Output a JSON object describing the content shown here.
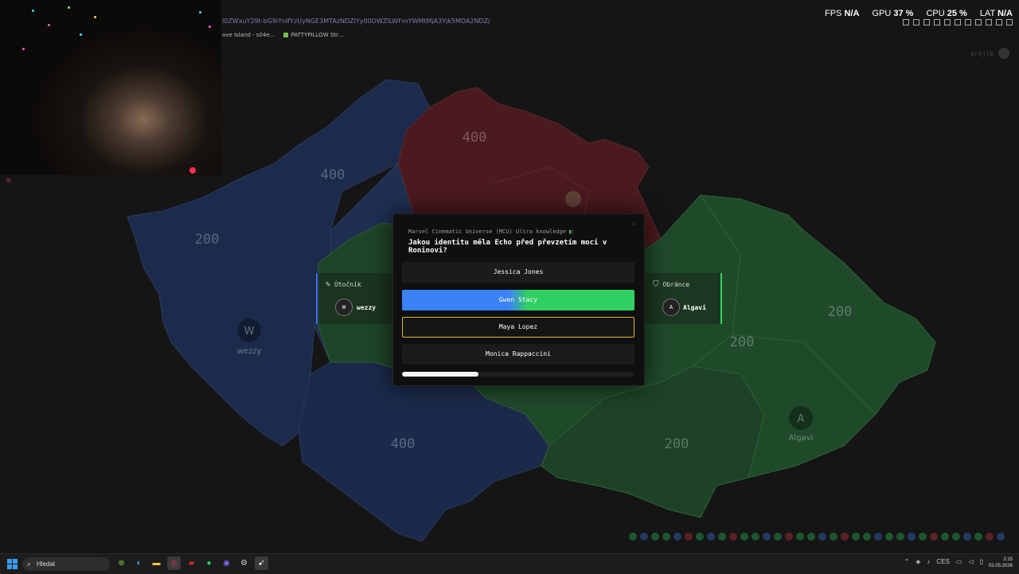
{
  "overlay": {
    "url": "l0ZWxuY29t-bG9iYnlfYzUyNGE3MTAzNDZlYy00OWZlLWFmYWMtMjA3Yjk5MDA2NDZj",
    "tabs": [
      "ove Island - s04e…",
      "PATTYPILLOW Str…"
    ],
    "perf": [
      {
        "label": "FPS",
        "value": "N/A"
      },
      {
        "label": "GPU",
        "value": "37 %"
      },
      {
        "label": "CPU",
        "value": "25 %"
      },
      {
        "label": "LAT",
        "value": "N/A"
      }
    ],
    "profile_name": "brejle"
  },
  "map": {
    "regions_text": [
      "400",
      "400",
      "200",
      "400",
      "200",
      "200",
      "200",
      "400"
    ],
    "attacker_marker": {
      "initial": "W",
      "name": "wezzy"
    },
    "defender_marker": {
      "initial": "A",
      "name": "Algavi"
    },
    "colors": {
      "attacker": "#1e2d4f",
      "defender": "#1e4a2a",
      "neutral": "#4a1a1e"
    }
  },
  "attacker_card": {
    "role": "Útočník",
    "initial": "W",
    "name": "wezzy"
  },
  "defender_card": {
    "role": "Obránce",
    "initial": "A",
    "name": "Algavi"
  },
  "quiz": {
    "category": "Marvel Cinematic Universe (MCU) Ultra knowledge",
    "question": "Jakou identitu měla Echo před převzetím moci v Roninovi?",
    "answers": [
      "Jessica Jones",
      "Gwen Stacy",
      "Maya Lopez",
      "Monica Rappaccini"
    ],
    "timer_fraction": 0.33
  },
  "taskbar": {
    "search_placeholder": "Hledat",
    "lang": "CES",
    "time": "2:15",
    "date": "02.05.2026"
  }
}
